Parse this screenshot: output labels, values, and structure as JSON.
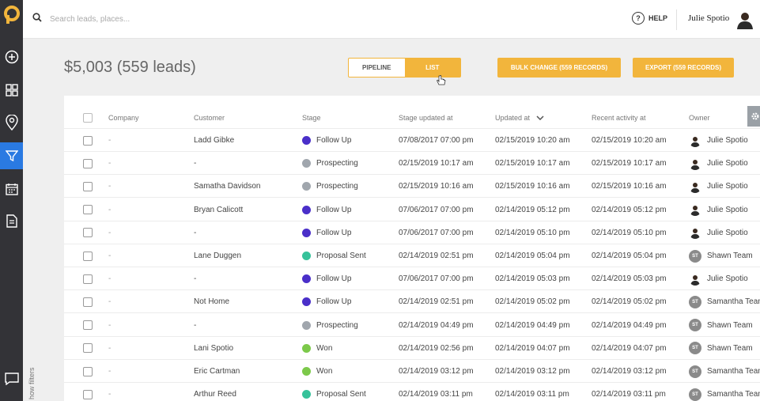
{
  "search": {
    "placeholder": "Search leads, places..."
  },
  "header": {
    "help_label": "HELP",
    "user_name": "Julie Spotio"
  },
  "summary": {
    "total": "$5,003 (559 leads)"
  },
  "view_toggle": {
    "pipeline_label": "PIPELINE",
    "list_label": "LIST",
    "active": "LIST"
  },
  "actions": {
    "bulk_label": "BULK CHANGE (559 RECORDS)",
    "export_label": "EXPORT (559 RECORDS)"
  },
  "sidebar": {
    "items": [
      "add-icon",
      "grid-icon",
      "map-pin-icon",
      "filter-icon",
      "calendar-icon",
      "document-icon",
      "chat-icon"
    ],
    "active": "filter-icon",
    "show_filters_label": "how filters"
  },
  "colors": {
    "accent": "#f2b53c",
    "sidebar_active": "#2a7ae2",
    "follow_up": "#4a2fc9",
    "prospecting": "#a0a6ad",
    "proposal_sent": "#36c29a",
    "won": "#7cc94a"
  },
  "table": {
    "columns": [
      "Company",
      "Customer",
      "Stage",
      "Stage updated at",
      "Updated at",
      "Recent activity at",
      "Owner"
    ],
    "sort_column": "Updated at",
    "rows": [
      {
        "company": "-",
        "customer": "Ladd Gibke",
        "stage": "Follow Up",
        "stage_color": "#4a2fc9",
        "stage_updated": "07/08/2017 07:00 pm",
        "updated": "02/15/2019 10:20 am",
        "recent": "02/15/2019 10:20 am",
        "owner": "Julie Spotio",
        "owner_type": "photo"
      },
      {
        "company": "-",
        "customer": "-",
        "stage": "Prospecting",
        "stage_color": "#a0a6ad",
        "stage_updated": "02/15/2019 10:17 am",
        "updated": "02/15/2019 10:17 am",
        "recent": "02/15/2019 10:17 am",
        "owner": "Julie Spotio",
        "owner_type": "photo"
      },
      {
        "company": "-",
        "customer": "Samatha Davidson",
        "stage": "Prospecting",
        "stage_color": "#a0a6ad",
        "stage_updated": "02/15/2019 10:16 am",
        "updated": "02/15/2019 10:16 am",
        "recent": "02/15/2019 10:16 am",
        "owner": "Julie Spotio",
        "owner_type": "photo"
      },
      {
        "company": "-",
        "customer": "Bryan Calicott",
        "stage": "Follow Up",
        "stage_color": "#4a2fc9",
        "stage_updated": "07/06/2017 07:00 pm",
        "updated": "02/14/2019 05:12 pm",
        "recent": "02/14/2019 05:12 pm",
        "owner": "Julie Spotio",
        "owner_type": "photo"
      },
      {
        "company": "-",
        "customer": "-",
        "stage": "Follow Up",
        "stage_color": "#4a2fc9",
        "stage_updated": "07/06/2017 07:00 pm",
        "updated": "02/14/2019 05:10 pm",
        "recent": "02/14/2019 05:10 pm",
        "owner": "Julie Spotio",
        "owner_type": "photo"
      },
      {
        "company": "-",
        "customer": "Lane Duggen",
        "stage": "Proposal Sent",
        "stage_color": "#36c29a",
        "stage_updated": "02/14/2019 02:51 pm",
        "updated": "02/14/2019 05:04 pm",
        "recent": "02/14/2019 05:04 pm",
        "owner": "Shawn Team",
        "owner_type": "ST"
      },
      {
        "company": "-",
        "customer": "-",
        "stage": "Follow Up",
        "stage_color": "#4a2fc9",
        "stage_updated": "07/06/2017 07:00 pm",
        "updated": "02/14/2019 05:03 pm",
        "recent": "02/14/2019 05:03 pm",
        "owner": "Julie Spotio",
        "owner_type": "photo"
      },
      {
        "company": "-",
        "customer": "Not Home",
        "stage": "Follow Up",
        "stage_color": "#4a2fc9",
        "stage_updated": "02/14/2019 02:51 pm",
        "updated": "02/14/2019 05:02 pm",
        "recent": "02/14/2019 05:02 pm",
        "owner": "Samantha Tean",
        "owner_type": "ST"
      },
      {
        "company": "-",
        "customer": "-",
        "stage": "Prospecting",
        "stage_color": "#a0a6ad",
        "stage_updated": "02/14/2019 04:49 pm",
        "updated": "02/14/2019 04:49 pm",
        "recent": "02/14/2019 04:49 pm",
        "owner": "Shawn Team",
        "owner_type": "ST"
      },
      {
        "company": "-",
        "customer": "Lani Spotio",
        "stage": "Won",
        "stage_color": "#7cc94a",
        "stage_updated": "02/14/2019 02:56 pm",
        "updated": "02/14/2019 04:07 pm",
        "recent": "02/14/2019 04:07 pm",
        "owner": "Shawn Team",
        "owner_type": "ST"
      },
      {
        "company": "-",
        "customer": "Eric Cartman",
        "stage": "Won",
        "stage_color": "#7cc94a",
        "stage_updated": "02/14/2019 03:12 pm",
        "updated": "02/14/2019 03:12 pm",
        "recent": "02/14/2019 03:12 pm",
        "owner": "Samantha Tean",
        "owner_type": "ST"
      },
      {
        "company": "-",
        "customer": "Arthur Reed",
        "stage": "Proposal Sent",
        "stage_color": "#36c29a",
        "stage_updated": "02/14/2019 03:11 pm",
        "updated": "02/14/2019 03:11 pm",
        "recent": "02/14/2019 03:11 pm",
        "owner": "Samantha Tean",
        "owner_type": "ST"
      }
    ]
  }
}
